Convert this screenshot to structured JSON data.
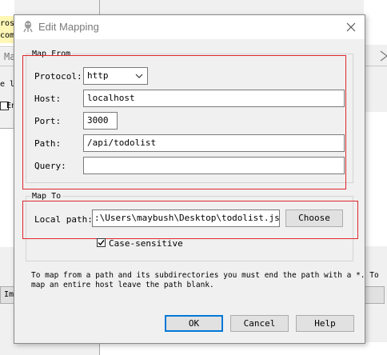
{
  "background": {
    "snippet_1": "ros",
    "snippet_2": "com",
    "snippet_3": "Ma",
    "snippet_4": "e l",
    "snippet_5": "En",
    "snippet_6": "Im"
  },
  "dialog": {
    "title": "Edit Mapping",
    "map_from": {
      "legend": "Map From",
      "protocol_label": "Protocol:",
      "protocol_value": "http",
      "host_label": "Host:",
      "host_value": "localhost",
      "port_label": "Port:",
      "port_value": "3000",
      "path_label": "Path:",
      "path_value": "/api/todolist",
      "query_label": "Query:",
      "query_value": ""
    },
    "map_to": {
      "legend": "Map To",
      "local_path_label": "Local path:",
      "local_path_value": ":\\Users\\maybush\\Desktop\\todolist.json",
      "choose_label": "Choose",
      "case_sensitive_label": "Case-sensitive",
      "case_sensitive_checked": true
    },
    "note_line1": "To map from a path and its subdirectories you must end the path with a *. To",
    "note_line2": "map an entire host leave the path blank.",
    "ok_label": "OK",
    "cancel_label": "Cancel",
    "help_label": "Help"
  },
  "colors": {
    "highlight_red": "#e0262e",
    "default_button_blue": "#0078d7"
  },
  "icons": {
    "app": "gecko-app-icon",
    "close": "close-icon",
    "dropdown": "chevron-down-icon",
    "check": "checkmark-icon"
  }
}
